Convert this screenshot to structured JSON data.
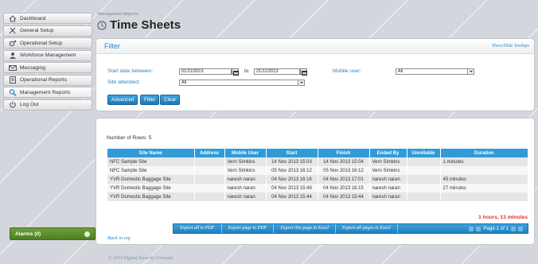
{
  "sidebar": {
    "items": [
      {
        "label": "Dashboard",
        "icon": "home-icon"
      },
      {
        "label": "General Setup",
        "icon": "tools-icon"
      },
      {
        "label": "Operational Setup",
        "icon": "gears-icon"
      },
      {
        "label": "Workforce Management",
        "icon": "users-icon"
      },
      {
        "label": "Messaging",
        "icon": "envelope-icon"
      },
      {
        "label": "Operational Reports",
        "icon": "report-icon"
      },
      {
        "label": "Management Reports",
        "icon": "magnifier-icon"
      },
      {
        "label": "Log Out",
        "icon": "power-icon"
      }
    ],
    "alarms_label": "Alarms (0)"
  },
  "header": {
    "breadcrumb": "Management Reports",
    "title": "Time Sheets"
  },
  "filter": {
    "title": "Filter",
    "tooltips_link": "Show/Hide Tooltips",
    "start_date_label": "Start date between:",
    "start_date_from": "01/11/2013",
    "to_label": "to",
    "start_date_to": "21/11/2013",
    "mobile_user_label": "Mobile user:",
    "mobile_user_value": "All",
    "site_label": "Site attended:",
    "site_value": "All",
    "buttons": {
      "advanced": "Advanced",
      "filter": "Filter",
      "clear": "Clear"
    }
  },
  "results": {
    "rows_count": "Number of Rows: 5",
    "columns": [
      "Site Name",
      "Address",
      "Mobile User",
      "Start",
      "Finish",
      "Ended By",
      "Unreliable",
      "Duration"
    ],
    "rows": [
      [
        "NFC Sample Site",
        "",
        "Vern Simkins",
        "14 Nov 2013 15:03",
        "14 Nov 2013 15:04",
        "Vern Simkins",
        "",
        "1 minutes"
      ],
      [
        "NFC Sample Site",
        "",
        "Vern Simkins",
        "05 Nov 2013 16:12",
        "05 Nov 2013 16:12",
        "Vern Simkins",
        "",
        ""
      ],
      [
        "YVR Domestic Baggage Site",
        "",
        "naresh naran",
        "04 Nov 2013 16:16",
        "04 Nov 2013 17:01",
        "naresh naran",
        "",
        "45 minutes"
      ],
      [
        "YVR Domestic Baggage Site",
        "",
        "naresh naran",
        "04 Nov 2013 15:48",
        "04 Nov 2013 16:15",
        "naresh naran",
        "",
        "27 minutes"
      ],
      [
        "YVR Domestic Baggage Site",
        "",
        "naresh naran",
        "04 Nov 2013 15:44",
        "04 Nov 2013 15:44",
        "naresh naran",
        "",
        ""
      ]
    ],
    "total_duration": "1 hours, 13 minutes",
    "export": {
      "all_pdf": "Export all to PDF",
      "page_pdf": "Export page to PDF",
      "page_excel": "Export this page to Excel",
      "all_excel": "Export all pages to Excel"
    },
    "pager": "Page 1 of 1",
    "back_to_top": "Back to top"
  },
  "footer": "© 2013 Digital Security Concepts",
  "colors": {
    "accent": "#2f9bd8",
    "link": "#2a86c5",
    "alarm_green": "#5d8f2e",
    "total_red": "#e53030"
  }
}
